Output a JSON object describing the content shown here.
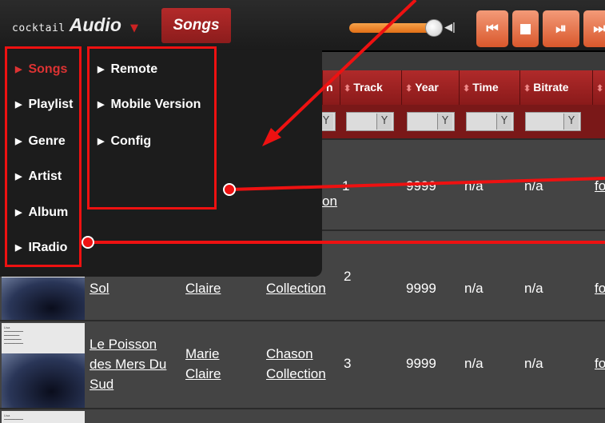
{
  "header": {
    "logo_prefix": "cocktail",
    "logo_main": "Audio",
    "logo_caret": "▼",
    "songs_tab": "Songs",
    "volume_fraction": 0.9,
    "controls": [
      "⏮",
      "■",
      "⏯",
      "⏭"
    ]
  },
  "table": {
    "columns": [
      "n",
      "Track",
      "Year",
      "Time",
      "Bitrate"
    ],
    "sort_glyph": "⬍",
    "filter_glyph": "Y",
    "rows": [
      {
        "track": "1",
        "year": "9999",
        "time": "n/a",
        "bitrate": "n/a",
        "extra": "fo",
        "collection": "on"
      },
      {
        "title": "Sol",
        "artist": "Claire",
        "album": "Collection",
        "track": "2",
        "year": "9999",
        "time": "n/a",
        "bitrate": "n/a",
        "extra": "fo"
      },
      {
        "title_lines": [
          "Le Poisson",
          "des Mers Du",
          "Sud"
        ],
        "artist_lines": [
          "Marie",
          "Claire"
        ],
        "album_lines": [
          "Chason",
          "Collection"
        ],
        "track": "3",
        "year": "9999",
        "time": "n/a",
        "bitrate": "n/a",
        "extra": "fo"
      }
    ]
  },
  "menu_left": [
    "Songs",
    "Playlist",
    "Genre",
    "Artist",
    "Album",
    "IRadio"
  ],
  "menu_right": [
    "Remote",
    "Mobile Version",
    "Config"
  ],
  "colors": {
    "accent": "#8c1c1c",
    "annotation": "#ee1111",
    "active": "#dd3333"
  }
}
